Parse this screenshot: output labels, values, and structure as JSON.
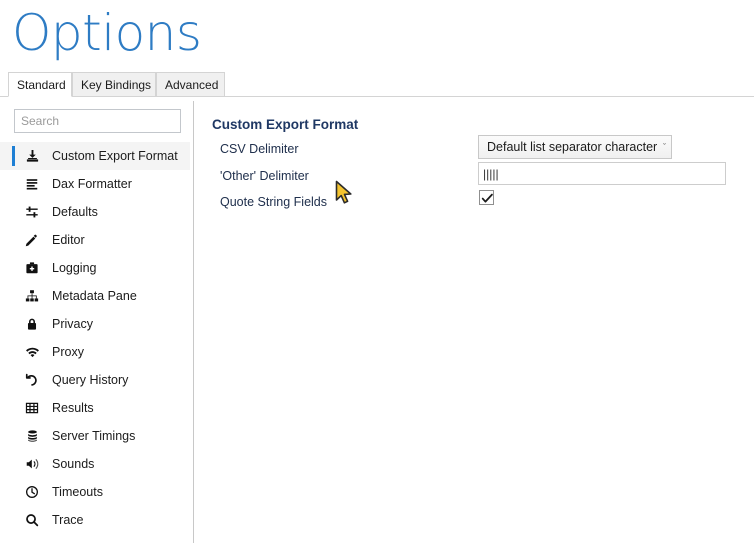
{
  "window": {
    "title": "Options"
  },
  "tabs": [
    {
      "label": "Standard",
      "active": true
    },
    {
      "label": "Key Bindings",
      "active": false
    },
    {
      "label": "Advanced",
      "active": false
    }
  ],
  "sidebar": {
    "search": {
      "value": "",
      "placeholder": "Search"
    },
    "items": [
      {
        "label": "Custom Export Format",
        "icon": "export-download-icon",
        "selected": true
      },
      {
        "label": "Dax Formatter",
        "icon": "lines-list-icon",
        "selected": false
      },
      {
        "label": "Defaults",
        "icon": "sliders-icon",
        "selected": false
      },
      {
        "label": "Editor",
        "icon": "pencil-icon",
        "selected": false
      },
      {
        "label": "Logging",
        "icon": "briefcase-icon",
        "selected": false
      },
      {
        "label": "Metadata Pane",
        "icon": "hierarchy-icon",
        "selected": false
      },
      {
        "label": "Privacy",
        "icon": "lock-icon",
        "selected": false
      },
      {
        "label": "Proxy",
        "icon": "wifi-icon",
        "selected": false
      },
      {
        "label": "Query History",
        "icon": "history-icon",
        "selected": false
      },
      {
        "label": "Results",
        "icon": "grid-table-icon",
        "selected": false
      },
      {
        "label": "Server Timings",
        "icon": "database-icon",
        "selected": false
      },
      {
        "label": "Sounds",
        "icon": "speaker-icon",
        "selected": false
      },
      {
        "label": "Timeouts",
        "icon": "clock-icon",
        "selected": false
      },
      {
        "label": "Trace",
        "icon": "magnifier-icon",
        "selected": false
      }
    ]
  },
  "main": {
    "heading": "Custom Export Format",
    "csv_delimiter": {
      "label": "CSV Delimiter",
      "selected_option": "Default list separator character",
      "arrow_glyph": "ˇ"
    },
    "other_delimiter": {
      "label": "'Other' Delimiter",
      "value": "|||||",
      "placeholder": ""
    },
    "quote_string_fields": {
      "label": "Quote String Fields",
      "checked": true
    }
  },
  "colors": {
    "title_blue": "#2E7CC4",
    "heading_navy": "#1F3864",
    "accent_bar_blue": "#1E7FD4",
    "selected_row_bg": "#f4f4f4",
    "cursor_yellow": "#F4C430"
  }
}
